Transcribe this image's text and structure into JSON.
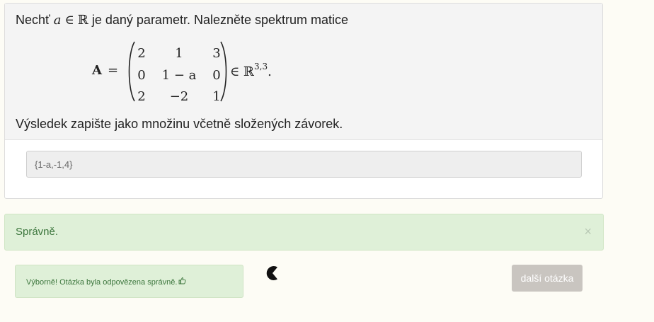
{
  "question": {
    "intro_prefix": "Nechť",
    "intro_var": "a",
    "intro_in": "∈",
    "intro_set": "ℝ",
    "intro_rest": "je daný parametr. Nalezněte spektrum matice",
    "matrix_symbol": "A",
    "equals": "=",
    "matrix": [
      [
        "2",
        "1",
        "3"
      ],
      [
        "0",
        "1 − a",
        "0"
      ],
      [
        "2",
        "−2",
        "1"
      ]
    ],
    "membership": "∈ ℝ",
    "dimension": "3,3",
    "terminator": ".",
    "instructions": "Výsledek zapište jako množinu včetně složených závorek."
  },
  "answer": {
    "value": "{1-a,-1,4}"
  },
  "alert": {
    "message": "Správně.",
    "close_symbol": "×"
  },
  "feedback": {
    "message": "Výborně! Otázka byla odpovězena správně.",
    "thumb_symbol": "👍"
  },
  "next_button": {
    "label": "další otázka"
  },
  "icons": {
    "close": "close-icon",
    "loader": "loader-icon",
    "thumb": "thumbs-up-icon"
  },
  "colors": {
    "page_background": "#fdfcf5",
    "success_background": "#dff0d8",
    "success_text": "#3c763d",
    "disabled_button": "#c9c5c0"
  }
}
